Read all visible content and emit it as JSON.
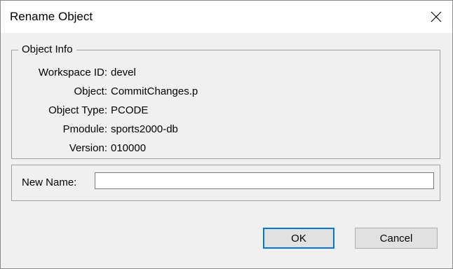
{
  "window": {
    "title": "Rename Object"
  },
  "object_info": {
    "legend": "Object Info",
    "rows": [
      {
        "label": "Workspace ID:",
        "value": "devel"
      },
      {
        "label": "Object:",
        "value": "CommitChanges.p"
      },
      {
        "label": "Object Type:",
        "value": "PCODE"
      },
      {
        "label": "Pmodule:",
        "value": "sports2000-db"
      },
      {
        "label": "Version:",
        "value": "010000"
      }
    ]
  },
  "new_name": {
    "label": "New Name:",
    "value": ""
  },
  "buttons": {
    "ok": "OK",
    "cancel": "Cancel"
  },
  "colors": {
    "focus_border": "#0078d7",
    "button_bg": "#e1e1e1",
    "dialog_bg": "#f0f0f0"
  },
  "icons": {
    "close": "close-icon"
  }
}
